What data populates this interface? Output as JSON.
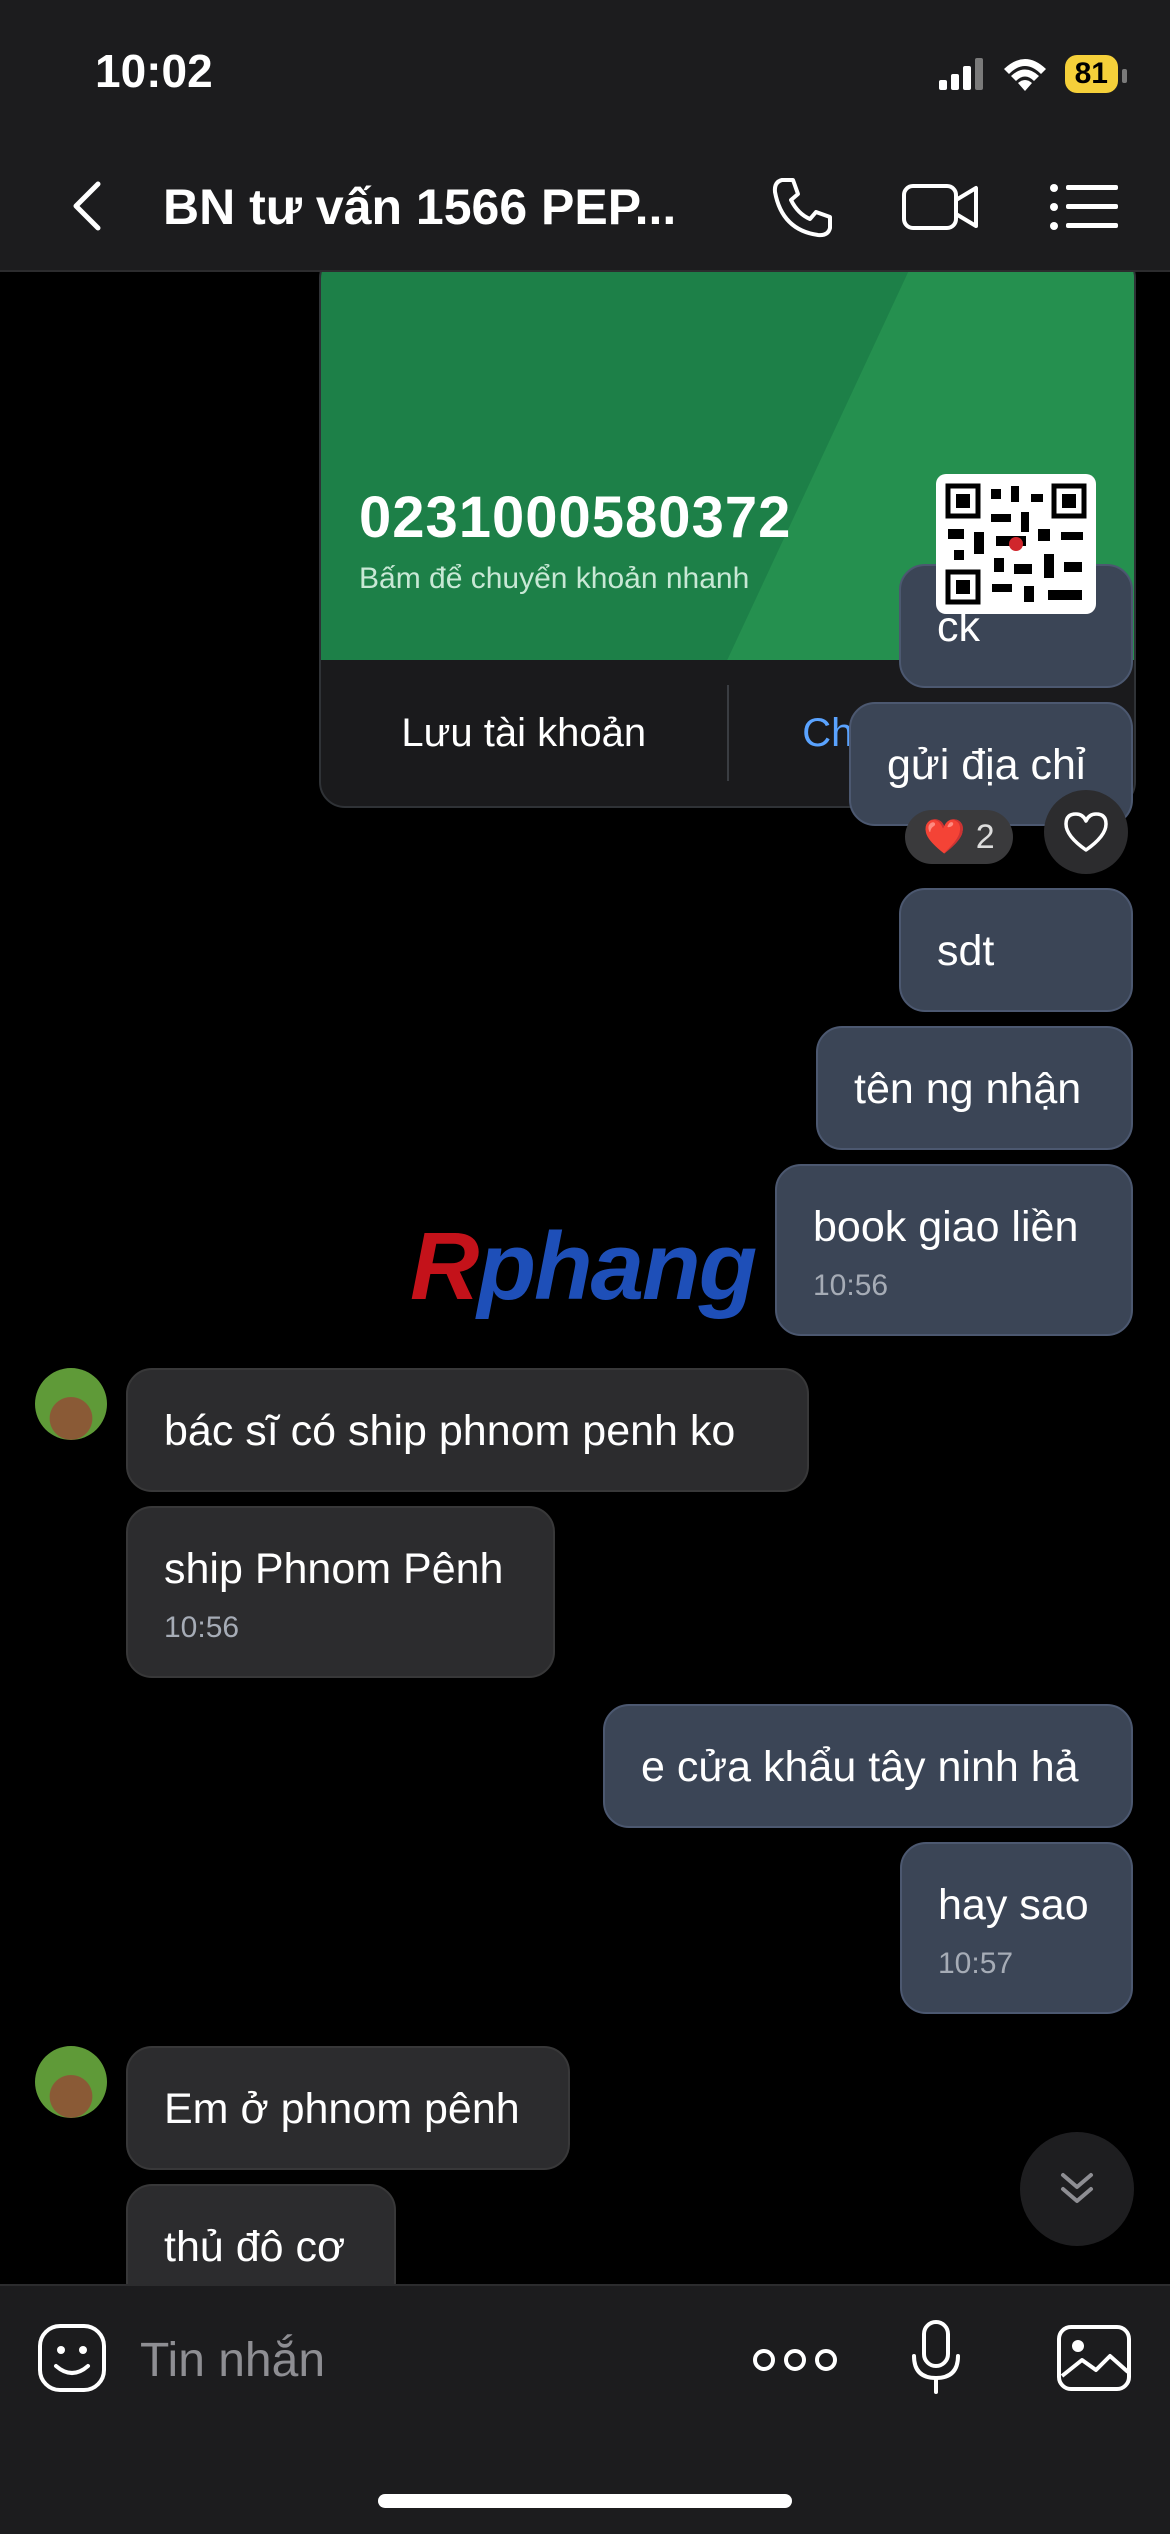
{
  "status_bar": {
    "time": "10:02",
    "battery": "81"
  },
  "header": {
    "title": "BN tư vấn 1566 PEP...",
    "icons": [
      "back-icon",
      "phone-icon",
      "video-call-icon",
      "menu-icon"
    ]
  },
  "bank_card": {
    "account_number": "0231000580372",
    "hint": "Bấm để chuyển khoản nhanh",
    "save_label": "Lưu tài khoản",
    "transfer_label": "Chuyển khoản",
    "accent_color": "#1d8048"
  },
  "messages": [
    {
      "from": "me",
      "text": "ck"
    },
    {
      "from": "me",
      "text": "gửi địa chỉ",
      "reaction": {
        "emoji": "❤️",
        "count": "2"
      }
    },
    {
      "from": "me",
      "text": "sdt"
    },
    {
      "from": "me",
      "text": "tên ng nhận"
    },
    {
      "from": "me",
      "text": "book giao liền",
      "time": "10:56"
    },
    {
      "from": "them",
      "text": "bác sĩ có ship phnom penh ko"
    },
    {
      "from": "them",
      "text": "ship Phnom Pênh",
      "time": "10:56"
    },
    {
      "from": "me",
      "text": "e cửa khẩu tây ninh hả"
    },
    {
      "from": "me",
      "text": "hay sao",
      "time": "10:57"
    },
    {
      "from": "them",
      "text": "Em ở phnom pênh"
    },
    {
      "from": "them",
      "text": "thủ đô cơ"
    }
  ],
  "watermark": {
    "r": "R",
    "rest": "phang"
  },
  "composer": {
    "placeholder": "Tin nhắn"
  },
  "colors": {
    "outgoing_bubble": "#3b4556",
    "incoming_bubble": "#2c2c2e",
    "link": "#5aa3ff",
    "battery": "#f5d03a"
  }
}
